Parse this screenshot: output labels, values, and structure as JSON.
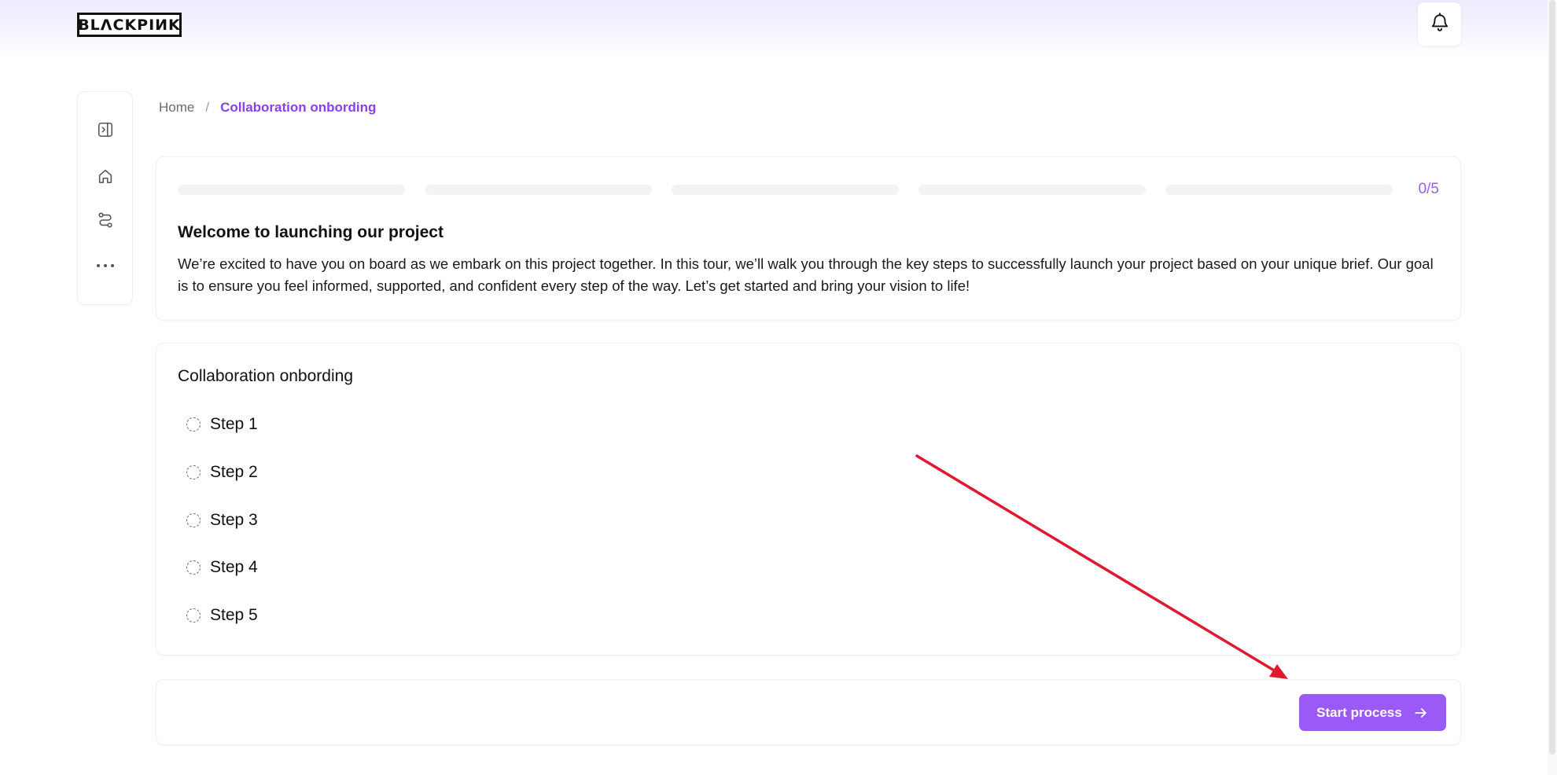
{
  "header": {
    "logo_text": "BLACKPINK",
    "notification_icon": "bell-icon"
  },
  "sidebar": {
    "items": [
      {
        "icon": "panel-toggle-icon"
      },
      {
        "icon": "home-icon"
      },
      {
        "icon": "route-icon"
      },
      {
        "icon": "more-icon"
      }
    ]
  },
  "breadcrumb": {
    "home": "Home",
    "separator": "/",
    "current": "Collaboration onbording"
  },
  "welcome": {
    "progress": {
      "completed": 0,
      "total": 5,
      "label": "0/5"
    },
    "title": "Welcome to launching our project",
    "description": "We’re excited to have you on board as we embark on this project together. In this tour, we’ll walk you through the key steps to successfully launch your project based on your unique brief. Our goal is to ensure you feel informed, supported, and confident every step of the way. Let’s get started and bring your vision to life!"
  },
  "steps": {
    "title": "Collaboration onbording",
    "items": [
      {
        "label": "Step 1"
      },
      {
        "label": "Step 2"
      },
      {
        "label": "Step 3"
      },
      {
        "label": "Step 4"
      },
      {
        "label": "Step 5"
      }
    ]
  },
  "footer": {
    "start_button_label": "Start process"
  },
  "colors": {
    "accent": "#9b59f5",
    "accent_text": "#8a3ef0",
    "annotation_arrow": "#e0192f"
  }
}
